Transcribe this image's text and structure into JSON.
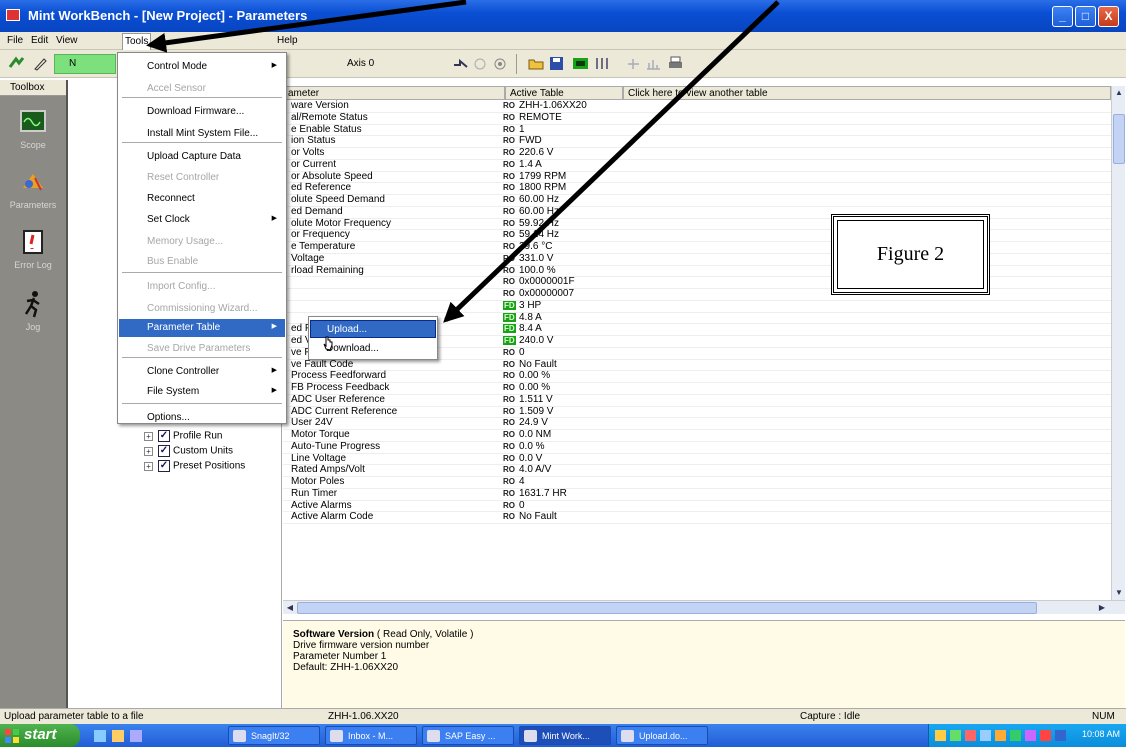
{
  "window": {
    "title": "Mint WorkBench - [New Project] - Parameters",
    "controls": [
      "_",
      "□",
      "X"
    ]
  },
  "menubar": [
    "File",
    "Edit",
    "View",
    "Tools",
    "Help"
  ],
  "toolbar": {
    "status_text": "N",
    "axis_label": "Axis 0"
  },
  "toolbox": {
    "header": "Toolbox",
    "tools": [
      "Scope",
      "Parameters",
      "Error Log",
      "Jog"
    ]
  },
  "tools_menu": {
    "items": [
      {
        "label": "Control Mode",
        "disabled": false,
        "submenu": true
      },
      {
        "label": "Accel Sensor",
        "disabled": true,
        "submenu": false
      },
      {
        "label": "Download Firmware...",
        "disabled": false,
        "submenu": false
      },
      {
        "label": "Install Mint System File...",
        "disabled": false,
        "submenu": false
      },
      {
        "label": "Upload Capture Data",
        "disabled": false,
        "submenu": false
      },
      {
        "label": "Reset Controller",
        "disabled": true,
        "submenu": false
      },
      {
        "label": "Reconnect",
        "disabled": false,
        "submenu": false
      },
      {
        "label": "Set Clock",
        "disabled": false,
        "submenu": true
      },
      {
        "label": "Memory Usage...",
        "disabled": true,
        "submenu": false
      },
      {
        "label": "Bus Enable",
        "disabled": true,
        "submenu": false
      },
      {
        "label": "Import Config...",
        "disabled": true,
        "submenu": false
      },
      {
        "label": "Commissioning Wizard...",
        "disabled": true,
        "submenu": false
      },
      {
        "label": "Parameter Table",
        "disabled": false,
        "submenu": true,
        "highlighted": true
      },
      {
        "label": "Save Drive Parameters",
        "disabled": true,
        "submenu": false
      },
      {
        "label": "Clone Controller",
        "disabled": false,
        "submenu": true
      },
      {
        "label": "File System",
        "disabled": false,
        "submenu": true
      },
      {
        "label": "Options...",
        "disabled": false,
        "submenu": false
      }
    ],
    "submenu_items": [
      {
        "label": "Upload...",
        "highlighted": true
      },
      {
        "label": "Download...",
        "highlighted": false
      }
    ]
  },
  "tree": {
    "items": [
      {
        "label": "Profile Run",
        "checked": true
      },
      {
        "label": "Custom Units",
        "checked": true
      },
      {
        "label": "Preset Positions",
        "checked": true
      }
    ]
  },
  "grid": {
    "columns": [
      "ameter",
      "Active Table",
      "Click here to view another table"
    ],
    "rows": [
      {
        "param": "ware Version",
        "flag": "RO",
        "value": "ZHH-1.06XX20"
      },
      {
        "param": "al/Remote Status",
        "flag": "RO",
        "value": "REMOTE"
      },
      {
        "param": "e Enable Status",
        "flag": "RO",
        "value": "1"
      },
      {
        "param": "ion Status",
        "flag": "RO",
        "value": "FWD"
      },
      {
        "param": "or Volts",
        "flag": "RO",
        "value": "220.6 V"
      },
      {
        "param": "or Current",
        "flag": "RO",
        "value": "1.4 A"
      },
      {
        "param": "or Absolute Speed",
        "flag": "RO",
        "value": "1799 RPM"
      },
      {
        "param": "ed Reference",
        "flag": "RO",
        "value": "1800 RPM"
      },
      {
        "param": "olute Speed Demand",
        "flag": "RO",
        "value": "60.00 Hz"
      },
      {
        "param": "ed Demand",
        "flag": "RO",
        "value": "60.00 Hz"
      },
      {
        "param": "olute Motor Frequency",
        "flag": "RO",
        "value": "59.92 Hz"
      },
      {
        "param": "or Frequency",
        "flag": "RO",
        "value": "59.14 Hz"
      },
      {
        "param": "e Temperature",
        "flag": "RO",
        "value": "29.6 °C"
      },
      {
        "param": "Voltage",
        "flag": "RO",
        "value": "331.0 V"
      },
      {
        "param": "rload Remaining",
        "flag": "RO",
        "value": "100.0 %"
      },
      {
        "param": "",
        "flag": "RO",
        "value": "0x0000001F"
      },
      {
        "param": "",
        "flag": "RO",
        "value": "0x00000007"
      },
      {
        "param": "",
        "flag": "FD",
        "value": "3 HP"
      },
      {
        "param": "",
        "flag": "FD",
        "value": "4.8 A"
      },
      {
        "param": "ed Peak Current",
        "flag": "FD",
        "value": "8.4 A"
      },
      {
        "param": "ed Voltage",
        "flag": "FD",
        "value": "240.0 V"
      },
      {
        "param": "ve Faults",
        "flag": "RO",
        "value": "0"
      },
      {
        "param": "ve Fault Code",
        "flag": "RO",
        "value": "No Fault"
      },
      {
        "param": "Process Feedforward",
        "flag": "RO",
        "value": "0.00 %"
      },
      {
        "param": "FB Process Feedback",
        "flag": "RO",
        "value": "0.00 %"
      },
      {
        "param": "ADC User Reference",
        "flag": "RO",
        "value": "1.511 V"
      },
      {
        "param": "ADC Current Reference",
        "flag": "RO",
        "value": "1.509 V"
      },
      {
        "param": "User 24V",
        "flag": "RO",
        "value": "24.9 V"
      },
      {
        "param": "Motor Torque",
        "flag": "RO",
        "value": "0.0 NM"
      },
      {
        "param": "Auto-Tune Progress",
        "flag": "RO",
        "value": "0.0 %"
      },
      {
        "param": "Line Voltage",
        "flag": "RO",
        "value": "0.0 V"
      },
      {
        "param": "Rated Amps/Volt",
        "flag": "RO",
        "value": "4.0 A/V"
      },
      {
        "param": "Motor Poles",
        "flag": "RO",
        "value": "4"
      },
      {
        "param": "Run Timer",
        "flag": "RO",
        "value": "1631.7 HR"
      },
      {
        "param": "Active Alarms",
        "flag": "RO",
        "value": "0"
      },
      {
        "param": "Active Alarm Code",
        "flag": "RO",
        "value": "No Fault"
      }
    ]
  },
  "description": {
    "title": "Software Version",
    "qualifier": "( Read Only, Volatile )",
    "lines": [
      "Drive firmware version number",
      "Parameter Number 1",
      "Default: ZHH-1.06XX20"
    ]
  },
  "statusbar": {
    "hint": "Upload parameter table to a file",
    "firmware": "ZHH-1.06.XX20",
    "capture": "Capture : Idle",
    "num": "NUM"
  },
  "taskbar": {
    "start": "start",
    "tasks": [
      "SnagIt/32",
      "Inbox - M...",
      "SAP Easy ...",
      "Mint Work...",
      "Upload.do..."
    ],
    "clock": "10:08 AM"
  },
  "figure_label": "Figure 2",
  "colors": {
    "title_bar": "#0a4fd4",
    "menu_highlight": "#316ac5",
    "fd_badge": "#18a218",
    "toolbox_bg": "#8c8a84"
  }
}
